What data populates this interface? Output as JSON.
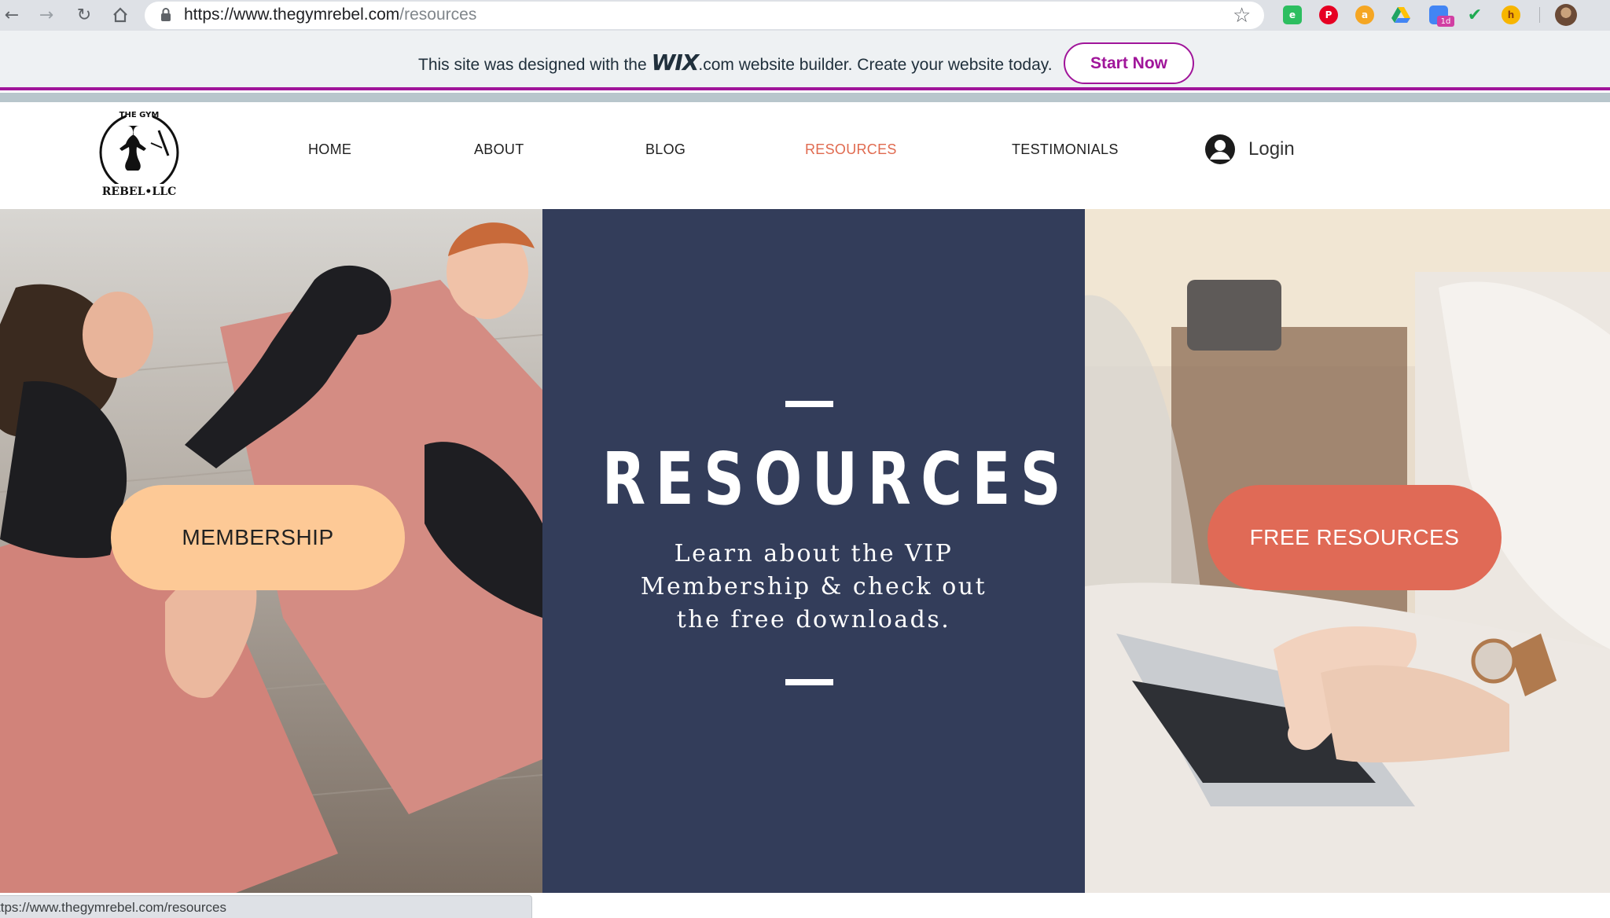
{
  "browser": {
    "url_host": "https://www.thegymrebel.com",
    "url_path": "/resources",
    "nav": {
      "back_icon": "arrow-left",
      "forward_icon": "arrow-right",
      "reload_icon": "reload",
      "home_icon": "home"
    },
    "extensions": [
      {
        "name": "evernote-icon",
        "color": "#2dbe60"
      },
      {
        "name": "pinterest-icon",
        "color": "#e60023"
      },
      {
        "name": "amazon-assistant-icon",
        "color": "#f5a623"
      },
      {
        "name": "google-drive-icon",
        "color": "#1fa463"
      },
      {
        "name": "calendar-icon",
        "color": "#4285f4",
        "badge": "1d"
      },
      {
        "name": "checkmark-icon",
        "color": "#1faa52"
      },
      {
        "name": "honey-icon",
        "color": "#f7b500"
      }
    ]
  },
  "wix_banner": {
    "text_before": "This site was designed with the ",
    "logo_text": "WIX",
    "text_after": ".com website builder. Create your website today.",
    "cta_label": "Start Now",
    "accent": "#a0159a"
  },
  "site": {
    "logo_alt": "THE GYM REBEL LLC",
    "nav": {
      "home": "HOME",
      "about": "ABOUT",
      "blog": "BLOG",
      "resources": "RESOURCES",
      "testimonials": "TESTIMONIALS"
    },
    "active_nav": "RESOURCES",
    "login_label": "Login",
    "active_color": "#e06a4f"
  },
  "hero": {
    "heading": "RESOURCES",
    "subtitle": "Learn about the VIP Membership & check out the free downloads.",
    "membership_label": "MEMBERSHIP",
    "free_resources_label": "FREE RESOURCES",
    "center_bg": "#333d5a",
    "membership_bg": "#fdc996",
    "free_bg": "#e06a56"
  },
  "status_bar": {
    "text": "ttps://www.thegymrebel.com/resources"
  }
}
